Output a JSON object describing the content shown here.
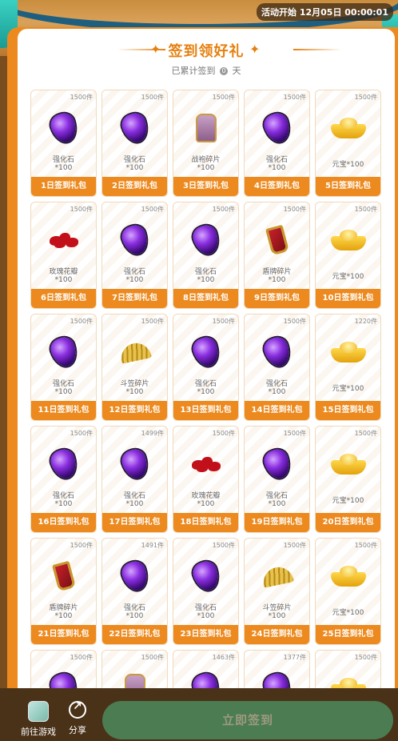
{
  "header": {
    "activity_time": "活动开始 12月05日 00:00:01"
  },
  "card": {
    "title": "签到领好礼",
    "subtitle_prefix": "已累计签到",
    "signed_days": "0",
    "subtitle_suffix": "天"
  },
  "rewards": [
    {
      "day": "1日签到礼包",
      "stock": "1500件",
      "name": "强化石",
      "qty": "*100",
      "icon": "gem-icon"
    },
    {
      "day": "2日签到礼包",
      "stock": "1500件",
      "name": "强化石",
      "qty": "*100",
      "icon": "gem-icon"
    },
    {
      "day": "3日签到礼包",
      "stock": "1500件",
      "name": "战袍碎片",
      "qty": "*100",
      "icon": "armor-icon"
    },
    {
      "day": "4日签到礼包",
      "stock": "1500件",
      "name": "强化石",
      "qty": "*100",
      "icon": "gem-icon"
    },
    {
      "day": "5日签到礼包",
      "stock": "1500件",
      "name": "元宝*100",
      "qty": "",
      "icon": "ingot-icon"
    },
    {
      "day": "6日签到礼包",
      "stock": "1500件",
      "name": "玫瑰花瓣",
      "qty": "*100",
      "icon": "petal-icon"
    },
    {
      "day": "7日签到礼包",
      "stock": "1500件",
      "name": "强化石",
      "qty": "*100",
      "icon": "gem-icon"
    },
    {
      "day": "8日签到礼包",
      "stock": "1500件",
      "name": "强化石",
      "qty": "*100",
      "icon": "gem-icon"
    },
    {
      "day": "9日签到礼包",
      "stock": "1500件",
      "name": "盾牌碎片",
      "qty": "*100",
      "icon": "shield-icon"
    },
    {
      "day": "10日签到礼包",
      "stock": "1500件",
      "name": "元宝*100",
      "qty": "",
      "icon": "ingot-icon"
    },
    {
      "day": "11日签到礼包",
      "stock": "1500件",
      "name": "强化石",
      "qty": "*100",
      "icon": "gem-icon"
    },
    {
      "day": "12日签到礼包",
      "stock": "1500件",
      "name": "斗笠碎片",
      "qty": "*100",
      "icon": "hat-icon"
    },
    {
      "day": "13日签到礼包",
      "stock": "1500件",
      "name": "强化石",
      "qty": "*100",
      "icon": "gem-icon"
    },
    {
      "day": "14日签到礼包",
      "stock": "1500件",
      "name": "强化石",
      "qty": "*100",
      "icon": "gem-icon"
    },
    {
      "day": "15日签到礼包",
      "stock": "1220件",
      "name": "元宝*100",
      "qty": "",
      "icon": "ingot-icon"
    },
    {
      "day": "16日签到礼包",
      "stock": "1500件",
      "name": "强化石",
      "qty": "*100",
      "icon": "gem-icon"
    },
    {
      "day": "17日签到礼包",
      "stock": "1499件",
      "name": "强化石",
      "qty": "*100",
      "icon": "gem-icon"
    },
    {
      "day": "18日签到礼包",
      "stock": "1500件",
      "name": "玫瑰花瓣",
      "qty": "*100",
      "icon": "petal-icon"
    },
    {
      "day": "19日签到礼包",
      "stock": "1500件",
      "name": "强化石",
      "qty": "*100",
      "icon": "gem-icon"
    },
    {
      "day": "20日签到礼包",
      "stock": "1500件",
      "name": "元宝*100",
      "qty": "",
      "icon": "ingot-icon"
    },
    {
      "day": "21日签到礼包",
      "stock": "1500件",
      "name": "盾牌碎片",
      "qty": "*100",
      "icon": "shield-icon"
    },
    {
      "day": "22日签到礼包",
      "stock": "1491件",
      "name": "强化石",
      "qty": "*100",
      "icon": "gem-icon"
    },
    {
      "day": "23日签到礼包",
      "stock": "1500件",
      "name": "强化石",
      "qty": "*100",
      "icon": "gem-icon"
    },
    {
      "day": "24日签到礼包",
      "stock": "1500件",
      "name": "斗笠碎片",
      "qty": "*100",
      "icon": "hat-icon"
    },
    {
      "day": "25日签到礼包",
      "stock": "1500件",
      "name": "元宝*100",
      "qty": "",
      "icon": "ingot-icon"
    },
    {
      "day": "",
      "stock": "1500件",
      "name": "",
      "qty": "",
      "icon": "gem-icon"
    },
    {
      "day": "",
      "stock": "1500件",
      "name": "",
      "qty": "",
      "icon": "armor-icon"
    },
    {
      "day": "",
      "stock": "1463件",
      "name": "",
      "qty": "",
      "icon": "gem-icon"
    },
    {
      "day": "",
      "stock": "1377件",
      "name": "",
      "qty": "",
      "icon": "gem-icon"
    },
    {
      "day": "",
      "stock": "1500件",
      "name": "",
      "qty": "",
      "icon": "ingot-icon"
    }
  ],
  "footer": {
    "game_label": "前往游戏",
    "share_label": "分享",
    "signin_label": "立即签到"
  },
  "colors": {
    "accent": "#ec8a1f",
    "button": "#4c7c52",
    "bar": "#4a3218"
  }
}
